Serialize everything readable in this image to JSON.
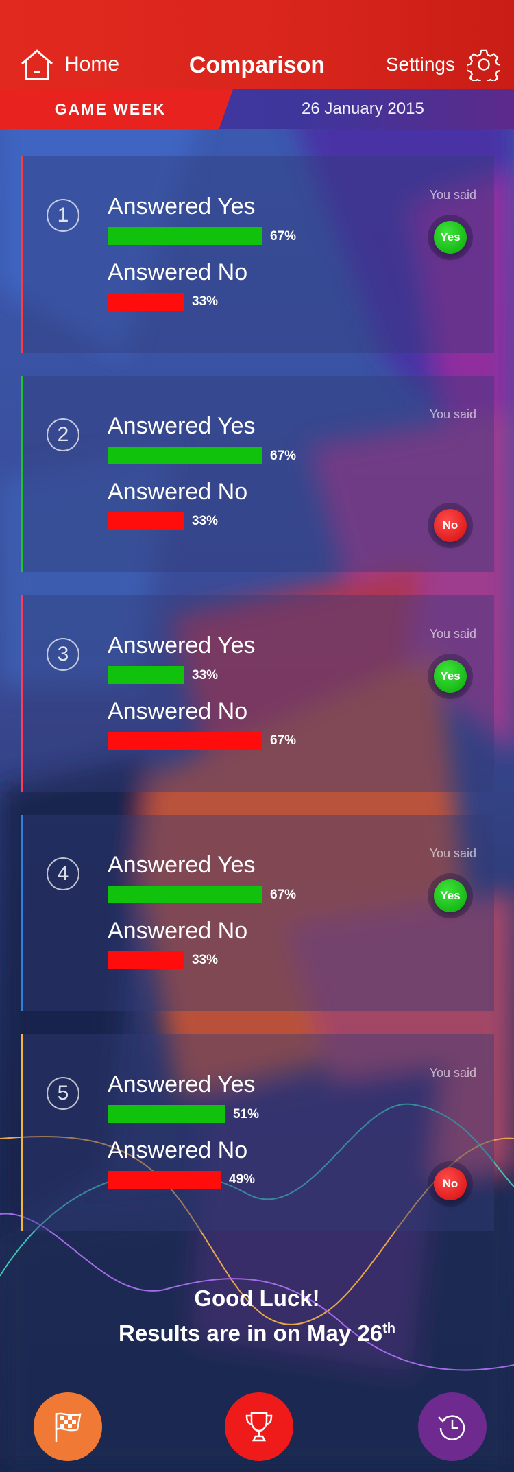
{
  "header": {
    "home_label": "Home",
    "title": "Comparison",
    "settings_label": "Settings"
  },
  "week": {
    "tag": "GAME WEEK",
    "date": "26 January 2015"
  },
  "labels": {
    "yes_row": "Answered Yes",
    "no_row": "Answered No",
    "you_said": "You said"
  },
  "questions": [
    {
      "number": "1",
      "yes_pct": "67%",
      "no_pct": "33%",
      "yes_fraction": 0.67,
      "no_fraction": 0.33,
      "answer": "Yes",
      "accent": "#ff3b3b"
    },
    {
      "number": "2",
      "yes_pct": "67%",
      "no_pct": "33%",
      "yes_fraction": 0.67,
      "no_fraction": 0.33,
      "answer": "No",
      "accent": "#22c22a"
    },
    {
      "number": "3",
      "yes_pct": "33%",
      "no_pct": "67%",
      "yes_fraction": 0.33,
      "no_fraction": 0.67,
      "answer": "Yes",
      "accent": "#ff3b5a"
    },
    {
      "number": "4",
      "yes_pct": "67%",
      "no_pct": "33%",
      "yes_fraction": 0.67,
      "no_fraction": 0.33,
      "answer": "Yes",
      "accent": "#2d7fe0"
    },
    {
      "number": "5",
      "yes_pct": "51%",
      "no_pct": "49%",
      "yes_fraction": 0.51,
      "no_fraction": 0.49,
      "answer": "No",
      "accent": "#f4b63a"
    }
  ],
  "footer": {
    "line1": "Good Luck!",
    "line2": "Results are in on May 26",
    "line2_sup": "th"
  },
  "colors": {
    "header_red": "#e2291f",
    "yes_green": "#10c20c",
    "no_red": "#ff0c0c",
    "fab_flag": "#f07a35",
    "fab_trophy": "#ef1a1a",
    "fab_history": "#6e2a8e"
  },
  "icons": {
    "home": "home-icon",
    "settings": "gear-icon",
    "flag": "checkered-flag-icon",
    "trophy": "trophy-icon",
    "history": "history-icon"
  }
}
